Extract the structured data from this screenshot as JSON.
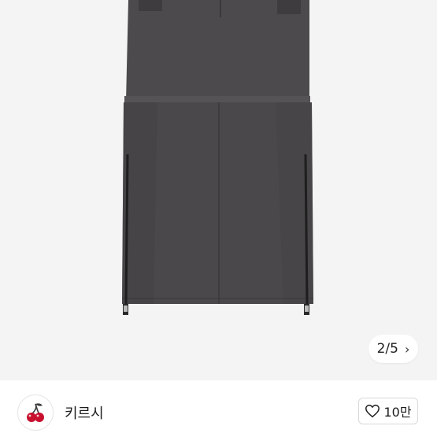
{
  "gallery": {
    "current_page": 2,
    "total_pages": 5,
    "indicator_text": "2/5",
    "next_icon": "chevron-right-icon",
    "background_color": "#f4f4f4",
    "garment_color": "#4c4a4c"
  },
  "seller": {
    "avatar_icon": "cherry-icon",
    "name": "키르시"
  },
  "like": {
    "icon": "heart-outline-icon",
    "count_label": "10만"
  }
}
